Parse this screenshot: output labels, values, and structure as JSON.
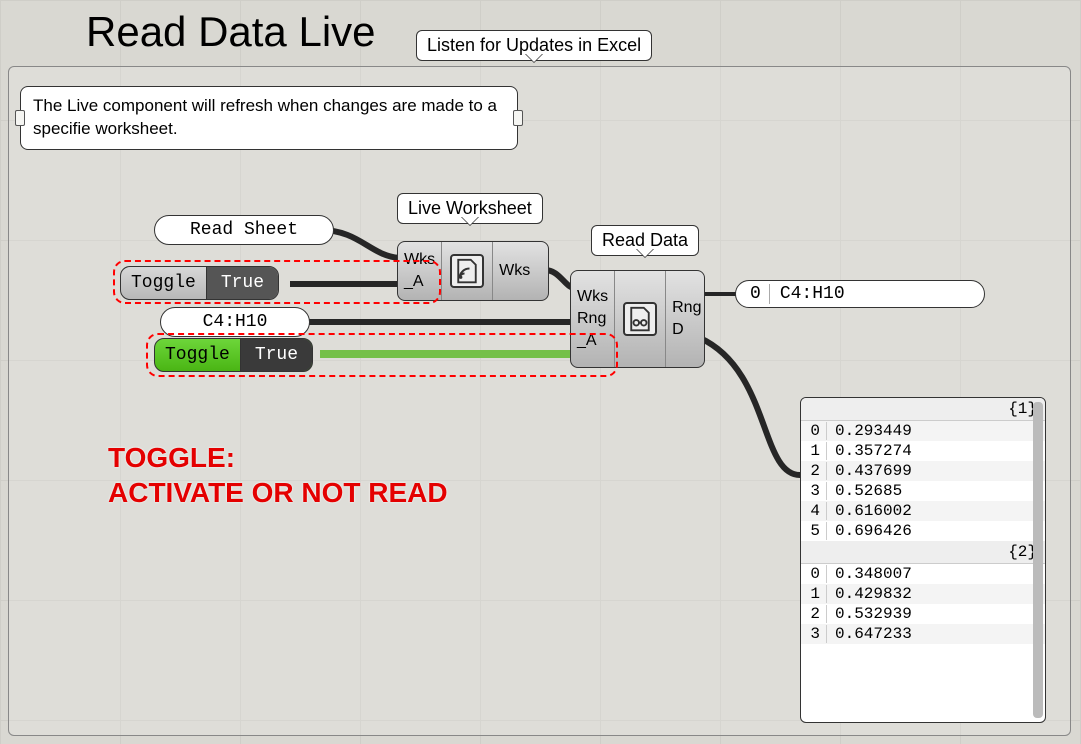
{
  "title": "Read Data Live",
  "group_label": "Listen for Updates in Excel",
  "description": "The Live component will refresh when changes are made to a specifie worksheet.",
  "inputs": {
    "read_sheet_panel": "Read Sheet",
    "toggle1": {
      "label": "Toggle",
      "value": "True"
    },
    "range_panel": "C4:H10",
    "toggle2": {
      "label": "Toggle",
      "value": "True"
    }
  },
  "components": {
    "live_worksheet": {
      "tag": "Live Worksheet",
      "inputs": [
        "Wks",
        "_A"
      ],
      "outputs": [
        "Wks"
      ]
    },
    "read_data": {
      "tag": "Read Data",
      "inputs": [
        "Wks",
        "Rng",
        "_A"
      ],
      "outputs": [
        "Rng",
        "D"
      ]
    }
  },
  "output_range": {
    "idx": "0",
    "val": "C4:H10"
  },
  "annotation_line1": "TOGGLE:",
  "annotation_line2": "ACTIVATE OR NOT READ",
  "data_panel": {
    "paths": [
      {
        "path": "{1}",
        "rows": [
          {
            "i": "0",
            "v": "0.293449"
          },
          {
            "i": "1",
            "v": "0.357274"
          },
          {
            "i": "2",
            "v": "0.437699"
          },
          {
            "i": "3",
            "v": "0.52685"
          },
          {
            "i": "4",
            "v": "0.616002"
          },
          {
            "i": "5",
            "v": "0.696426"
          }
        ]
      },
      {
        "path": "{2}",
        "rows": [
          {
            "i": "0",
            "v": "0.348007"
          },
          {
            "i": "1",
            "v": "0.429832"
          },
          {
            "i": "2",
            "v": "0.532939"
          },
          {
            "i": "3",
            "v": "0.647233"
          }
        ]
      }
    ]
  }
}
